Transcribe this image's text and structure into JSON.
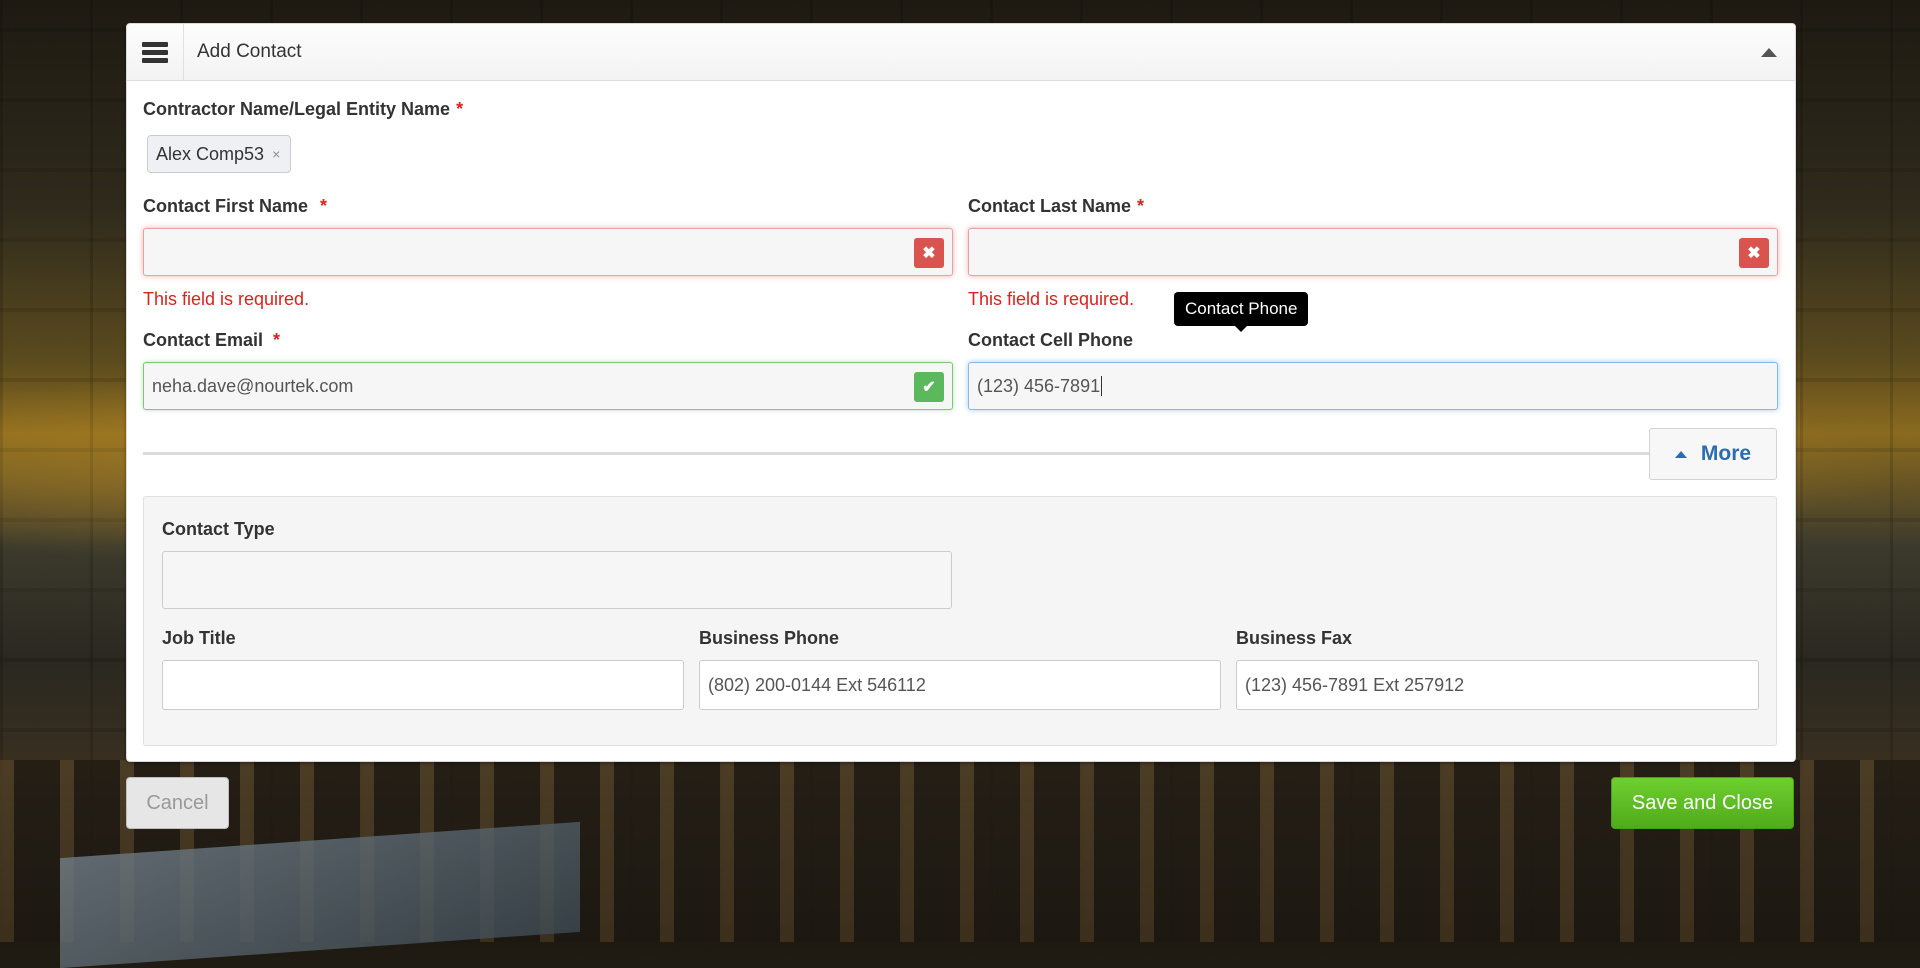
{
  "panel": {
    "title": "Add Contact"
  },
  "contractor": {
    "label": "Contractor Name/Legal Entity Name",
    "required_mark": "*",
    "tag_value": "Alex Comp53",
    "tag_remove": "×"
  },
  "first_name": {
    "label": "Contact First Name",
    "required_mark": "*",
    "value": "",
    "error": "This field is required."
  },
  "last_name": {
    "label": "Contact Last Name",
    "required_mark": "*",
    "value": "",
    "error": "This field is required."
  },
  "email": {
    "label": "Contact Email",
    "required_mark": "*",
    "value": "neha.dave@nourtek.com"
  },
  "cell_phone": {
    "label": "Contact Cell Phone",
    "value": "(123) 456-7891",
    "tooltip": "Contact Phone"
  },
  "more_button": {
    "label": "More"
  },
  "contact_type": {
    "label": "Contact Type",
    "value": ""
  },
  "job_title": {
    "label": "Job Title",
    "value": ""
  },
  "business_phone": {
    "label": "Business Phone",
    "value": "(802) 200-0144 Ext 546112"
  },
  "business_fax": {
    "label": "Business Fax",
    "value": "(123) 456-7891 Ext 257912"
  },
  "footer": {
    "cancel_label": "Cancel",
    "save_label": "Save and Close"
  },
  "icons": {
    "error_badge": "✖",
    "success_badge": "✔"
  },
  "colors": {
    "required": "#d9231d",
    "error_badge": "#d9534f",
    "success_badge": "#5cb85c",
    "link_blue": "#2a6db0",
    "save_green": "#5cbd24"
  }
}
